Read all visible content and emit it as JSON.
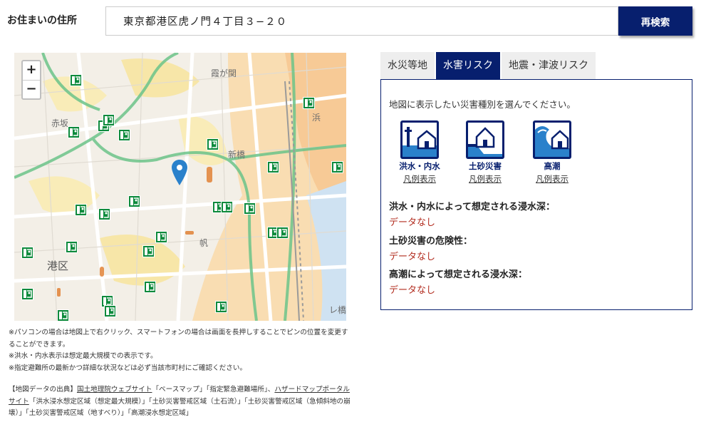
{
  "address": {
    "label": "お住まいの住所",
    "value": "東京都港区虎ノ門４丁目３−２０",
    "search_button": "再検索"
  },
  "map": {
    "zoom_in": "+",
    "zoom_out": "−",
    "labels": {
      "akasaka": "赤坂",
      "kasumigaseki": "霞が関",
      "shinbashi": "新橋",
      "minato": "港区",
      "hama": "浜",
      "fune": "帆",
      "bridge": "レ橋"
    },
    "icons": [
      "zoom-in-icon",
      "zoom-out-icon",
      "location-pin-icon",
      "evacuation-shelter-icon"
    ]
  },
  "notes": [
    "※パソコンの場合は地図上で右クリック、スマートフォンの場合は画面を長押しすることでピンの位置を変更することができます。",
    "※洪水・内水表示は想定最大規模での表示です。",
    "※指定避難所の最新かつ詳細な状況などは必ず当該市町村にご確認ください。"
  ],
  "source": {
    "prefix": "【地図データの出典】",
    "link1": "国土地理院ウェブサイト",
    "middle": "「ベースマップ」「指定緊急避難場所」、",
    "link2": "ハザードマップポータルサイト",
    "suffix": "「洪水浸水想定区域（想定最大規模）」「土砂災害警戒区域（土石流）」「土砂災害警戒区域（急傾斜地の崩壊）」「土砂災害警戒区域（地すべり）」「高潮浸水想定区域」"
  },
  "tabs": [
    {
      "label": "水災等地",
      "active": false
    },
    {
      "label": "水害リスク",
      "active": true
    },
    {
      "label": "地震・津波リスク",
      "active": false
    }
  ],
  "panel": {
    "prompt": "地図に表示したい災害種別を選んでください。",
    "hazards": [
      {
        "name": "洪水・内水",
        "legend": "凡例表示",
        "icon": "flood-icon"
      },
      {
        "name": "土砂災害",
        "legend": "凡例表示",
        "icon": "landslide-icon"
      },
      {
        "name": "高潮",
        "legend": "凡例表示",
        "icon": "storm-surge-icon"
      }
    ],
    "results": [
      {
        "question": "洪水・内水によって想定される浸水深：",
        "answer": "データなし"
      },
      {
        "question": "土砂災害の危険性：",
        "answer": "データなし"
      },
      {
        "question": "高潮によって想定される浸水深：",
        "answer": "データなし"
      }
    ]
  },
  "colors": {
    "brand_navy": "#071f6e",
    "answer_red": "#b22b1e",
    "shelter_green": "#0d8a3c",
    "pin_blue": "#2a81cb"
  }
}
